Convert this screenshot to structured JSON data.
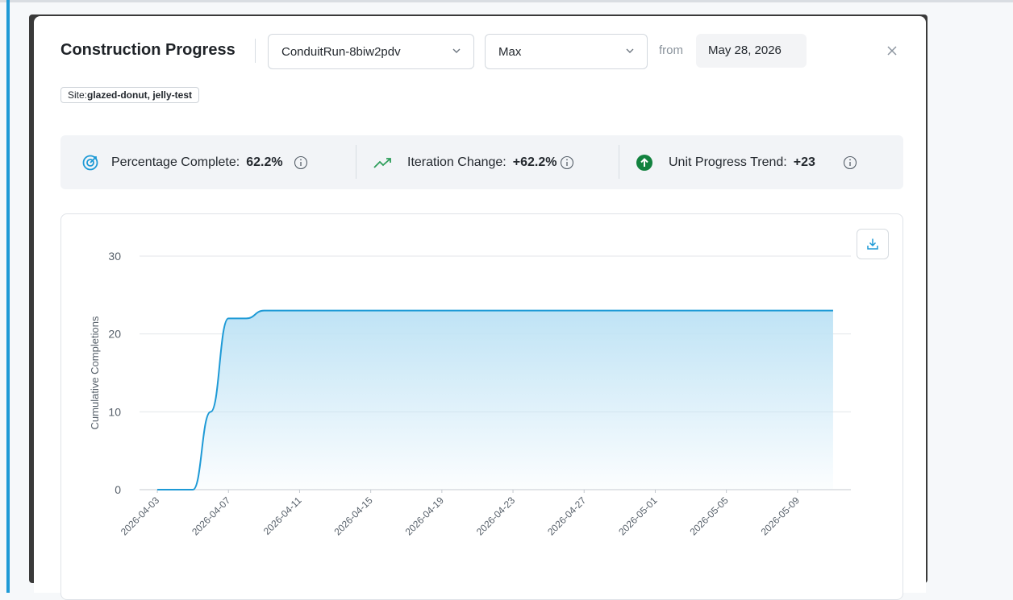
{
  "modal": {
    "title": "Construction Progress",
    "run_select": {
      "value": "ConduitRun-8biw2pdv"
    },
    "range_select": {
      "value": "Max"
    },
    "from_label": "from",
    "from_date": "May 28, 2026",
    "filter_chip": {
      "key": "Site:",
      "value": "glazed-donut, jelly-test"
    }
  },
  "stats": {
    "percentage_complete": {
      "label": "Percentage Complete:",
      "value": "62.2%",
      "icon": "target-icon",
      "color": "#1e9ad6"
    },
    "iteration_change": {
      "label": "Iteration Change:",
      "value": "+62.2%",
      "icon": "trending-up-icon",
      "color": "#2e9e5b"
    },
    "unit_progress_trend": {
      "label": "Unit Progress Trend:",
      "value": "+23",
      "icon": "arrow-up-circle-icon",
      "color": "#13823f"
    }
  },
  "chart_data": {
    "type": "area",
    "title": "",
    "xlabel": "",
    "ylabel": "Cumulative Completions",
    "ylim": [
      0,
      30
    ],
    "yticks": [
      0,
      10,
      20,
      30
    ],
    "xlim": [
      "2026-04-02",
      "2026-05-12"
    ],
    "xticks": [
      "2026-04-03",
      "2026-04-07",
      "2026-04-11",
      "2026-04-15",
      "2026-04-19",
      "2026-04-23",
      "2026-04-27",
      "2026-05-01",
      "2026-05-05",
      "2026-05-09"
    ],
    "grid": true,
    "line_color": "#1e9ad6",
    "fill_color": "#bfe3f5",
    "x": [
      "2026-04-03",
      "2026-04-04",
      "2026-04-05",
      "2026-04-06",
      "2026-04-07",
      "2026-04-08",
      "2026-04-09",
      "2026-04-10",
      "2026-05-11"
    ],
    "values": [
      0,
      0,
      0,
      10,
      22,
      22,
      23,
      23,
      23
    ]
  }
}
